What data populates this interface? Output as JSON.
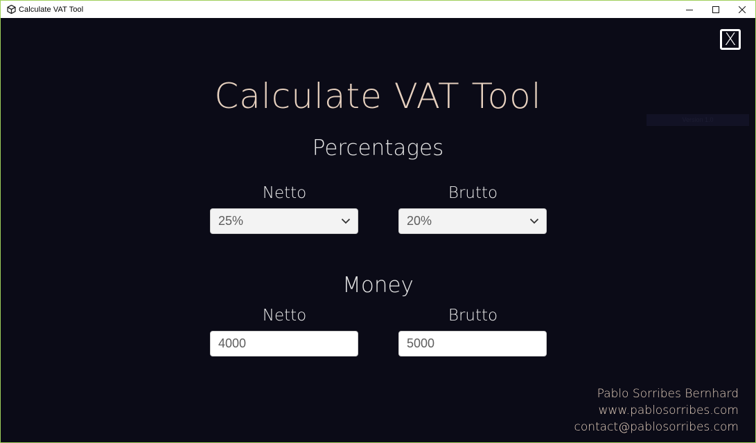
{
  "window": {
    "title": "Calculate VAT Tool",
    "app_icon": "unity-icon",
    "controls": {
      "minimize": "minimize-icon",
      "maximize": "maximize-icon",
      "close": "close-icon"
    }
  },
  "app": {
    "close_label": "X",
    "faint_bar_text": "Version 1.0",
    "title": "Calculate VAT Tool",
    "percentages": {
      "heading": "Percentages",
      "netto_label": "Netto",
      "netto_value": "25%",
      "brutto_label": "Brutto",
      "brutto_value": "20%"
    },
    "money": {
      "heading": "Money",
      "netto_label": "Netto",
      "netto_value": "4000",
      "brutto_label": "Brutto",
      "brutto_value": "5000"
    },
    "credits": {
      "name": "Pablo Sorribes Bernhard",
      "website": "www.pablosorribes.com",
      "email": "contact@pablosorribes.com"
    }
  },
  "colors": {
    "background": "#0b0b17",
    "title": "#e7d1bf",
    "heading": "#e6e6e6",
    "credits": "#e4cfbd",
    "window_border": "#9fcf5a"
  }
}
